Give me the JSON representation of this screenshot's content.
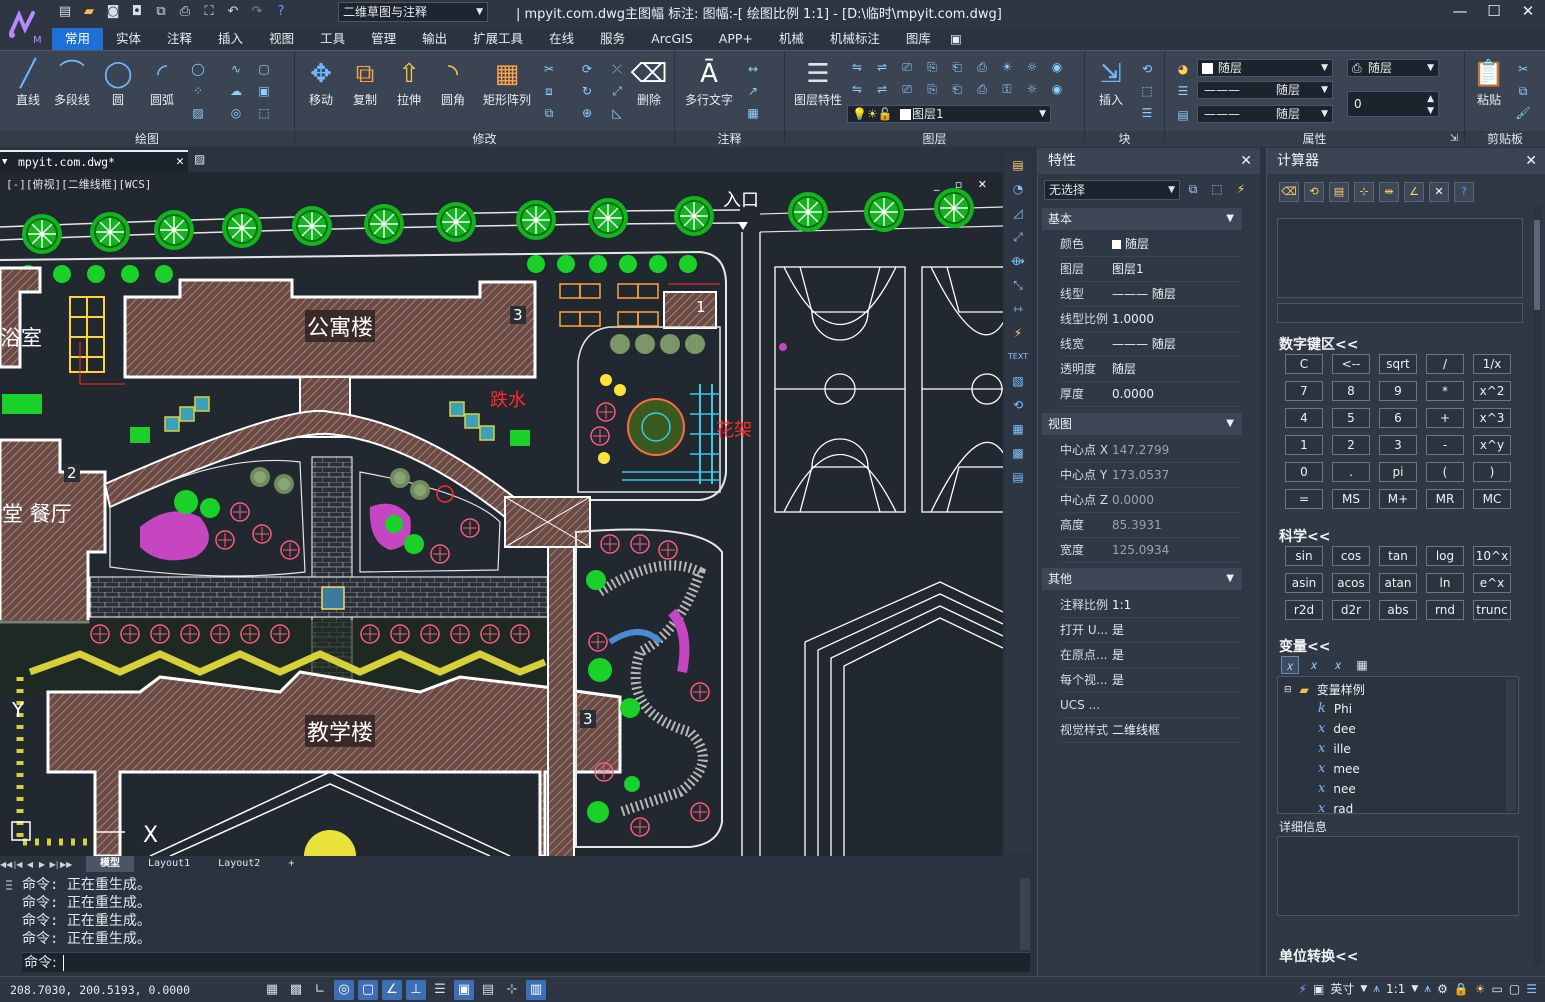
{
  "app": {
    "title": "| mpyit.com.dwg主图幅  标注: 图幅:-[ 绘图比例 1:1] - [D:\\临时\\mpyit.com.dwg]",
    "workspace": "二维草图与注释"
  },
  "menu": [
    "常用",
    "实体",
    "注释",
    "插入",
    "视图",
    "工具",
    "管理",
    "输出",
    "扩展工具",
    "在线",
    "服务",
    "ArcGIS",
    "APP+",
    "机械",
    "机械标注",
    "图库"
  ],
  "ribbon": {
    "draw": {
      "label": "绘图",
      "buttons": [
        "直线",
        "多段线",
        "圆",
        "圆弧"
      ]
    },
    "modify": {
      "label": "修改",
      "buttons": [
        "移动",
        "复制",
        "拉伸",
        "圆角",
        "矩形阵列",
        "删除"
      ]
    },
    "annotate": {
      "label": "注释",
      "buttons": [
        "多行文字"
      ]
    },
    "layers": {
      "label": "图层",
      "buttons": [
        "图层特性"
      ],
      "current_layer": "图层1"
    },
    "block": {
      "label": "块",
      "buttons": [
        "插入"
      ]
    },
    "properties": {
      "label": "属性",
      "color": "随层",
      "linetype": "随层",
      "lineweight": "随层",
      "plotstyle": "随层",
      "transparency": "0"
    },
    "clipboard": {
      "label": "剪贴板",
      "buttons": [
        "粘贴"
      ]
    }
  },
  "document": {
    "tab": "mpyit.com.dwg*",
    "view_label": "[-][俯视][二维线框][WCS]",
    "drawing_labels": {
      "entrance": "入口",
      "apartment": "公寓楼",
      "bath": "浴室",
      "canteen": "堂 餐厅",
      "teaching": "教学楼",
      "fountain": "跌水",
      "pergola": "花架",
      "n3a": "3",
      "n1": "1",
      "n2": "2",
      "n3b": "3"
    }
  },
  "layouts": [
    "模型",
    "Layout1",
    "Layout2",
    "+"
  ],
  "command": {
    "history": [
      "命令: 正在重生成。",
      "命令: 正在重生成。",
      "命令: 正在重生成。",
      "命令: 正在重生成。"
    ],
    "prompt": "命令: "
  },
  "status": {
    "coords": "208.7030, 200.5193, 0.0000",
    "scale": "1:1",
    "lang": "英寸"
  },
  "properties_panel": {
    "title": "特性",
    "selection": "无选择",
    "sections": {
      "basic": "基本",
      "view": "视图",
      "misc": "其他"
    },
    "basic": [
      {
        "k": "颜色",
        "v": "随层"
      },
      {
        "k": "图层",
        "v": "图层1"
      },
      {
        "k": "线型",
        "v": "——— 随层"
      },
      {
        "k": "线型比例",
        "v": "1.0000"
      },
      {
        "k": "线宽",
        "v": "——— 随层"
      },
      {
        "k": "透明度",
        "v": "随层"
      },
      {
        "k": "厚度",
        "v": "0.0000"
      }
    ],
    "view": [
      {
        "k": "中心点 X",
        "v": "147.2799"
      },
      {
        "k": "中心点 Y",
        "v": "173.0537"
      },
      {
        "k": "中心点 Z",
        "v": "0.0000"
      },
      {
        "k": "高度",
        "v": "85.3931"
      },
      {
        "k": "宽度",
        "v": "125.0934"
      }
    ],
    "misc": [
      {
        "k": "注释比例",
        "v": "1:1"
      },
      {
        "k": "打开 U...",
        "v": "是"
      },
      {
        "k": "在原点...",
        "v": "是"
      },
      {
        "k": "每个视...",
        "v": "是"
      },
      {
        "k": "UCS ...",
        "v": ""
      },
      {
        "k": "视觉样式",
        "v": "二维线框"
      }
    ]
  },
  "calculator": {
    "title": "计算器",
    "numpad_label": "数字键区<<",
    "numpad": [
      "C",
      "<--",
      "sqrt",
      "/",
      "1/x",
      "7",
      "8",
      "9",
      "*",
      "x^2",
      "4",
      "5",
      "6",
      "+",
      "x^3",
      "1",
      "2",
      "3",
      "-",
      "x^y",
      "0",
      ".",
      "pi",
      "(",
      ")",
      "=",
      "MS",
      "M+",
      "MR",
      "MC"
    ],
    "science_label": "科学<<",
    "science": [
      "sin",
      "cos",
      "tan",
      "log",
      "10^x",
      "asin",
      "acos",
      "atan",
      "ln",
      "e^x",
      "r2d",
      "d2r",
      "abs",
      "rnd",
      "trunc"
    ],
    "vars_label": "变量<<",
    "var_root": "变量样例",
    "vars": [
      {
        "icon": "k",
        "name": "Phi"
      },
      {
        "icon": "x",
        "name": "dee"
      },
      {
        "icon": "x",
        "name": "ille"
      },
      {
        "icon": "x",
        "name": "mee"
      },
      {
        "icon": "x",
        "name": "nee"
      },
      {
        "icon": "x",
        "name": "rad"
      }
    ],
    "detail_label": "详细信息",
    "unit_label": "单位转换<<"
  }
}
